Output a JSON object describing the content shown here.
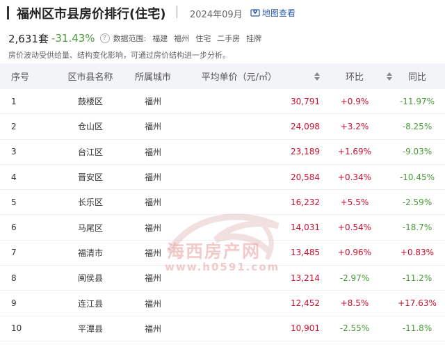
{
  "header": {
    "title": "福州区市县房价排行(住宅)",
    "date": "2024年09月",
    "map_link": "地图查看"
  },
  "stats": {
    "count": "2,631套",
    "change": "-31.43%",
    "scope_label": "数据范围:",
    "scope_items": [
      "福建",
      "福州",
      "住宅",
      "二手房",
      "挂牌"
    ]
  },
  "note": "房价波动受供给量、结构变化影响，可通过房价结构进一步分析。",
  "table": {
    "headers": {
      "rank": "序号",
      "district": "区市县名称",
      "city": "所属城市",
      "price": "平均单价（元/㎡）",
      "mom": "环比",
      "yoy": "同比"
    },
    "rows": [
      {
        "rank": "1",
        "district": "鼓楼区",
        "city": "福州",
        "price": "30,791",
        "mom": "+0.9%",
        "yoy": "-11.97%"
      },
      {
        "rank": "2",
        "district": "仓山区",
        "city": "福州",
        "price": "24,098",
        "mom": "+3.2%",
        "yoy": "-8.25%"
      },
      {
        "rank": "3",
        "district": "台江区",
        "city": "福州",
        "price": "23,189",
        "mom": "+1.69%",
        "yoy": "-9.03%"
      },
      {
        "rank": "4",
        "district": "晋安区",
        "city": "福州",
        "price": "20,584",
        "mom": "+0.34%",
        "yoy": "-10.45%"
      },
      {
        "rank": "5",
        "district": "长乐区",
        "city": "福州",
        "price": "16,232",
        "mom": "+5.5%",
        "yoy": "-2.59%"
      },
      {
        "rank": "6",
        "district": "马尾区",
        "city": "福州",
        "price": "14,031",
        "mom": "+0.54%",
        "yoy": "-18.7%"
      },
      {
        "rank": "7",
        "district": "福清市",
        "city": "福州",
        "price": "13,485",
        "mom": "+0.96%",
        "yoy": "+0.83%"
      },
      {
        "rank": "8",
        "district": "闽侯县",
        "city": "福州",
        "price": "13,214",
        "mom": "-2.97%",
        "yoy": "-11.2%"
      },
      {
        "rank": "9",
        "district": "连江县",
        "city": "福州",
        "price": "12,452",
        "mom": "+8.5%",
        "yoy": "+17.63%"
      },
      {
        "rank": "10",
        "district": "平潭县",
        "city": "福州",
        "price": "10,901",
        "mom": "-2.55%",
        "yoy": "-11.8%"
      }
    ]
  },
  "watermark": {
    "text": "海西房产网",
    "url": "www.h0591.com"
  },
  "colors": {
    "price": "#c8102e",
    "positive": "#c8102e",
    "negative": "#4a9a3a",
    "link": "#2a5caa",
    "header_bg": "#f2f4f7"
  }
}
